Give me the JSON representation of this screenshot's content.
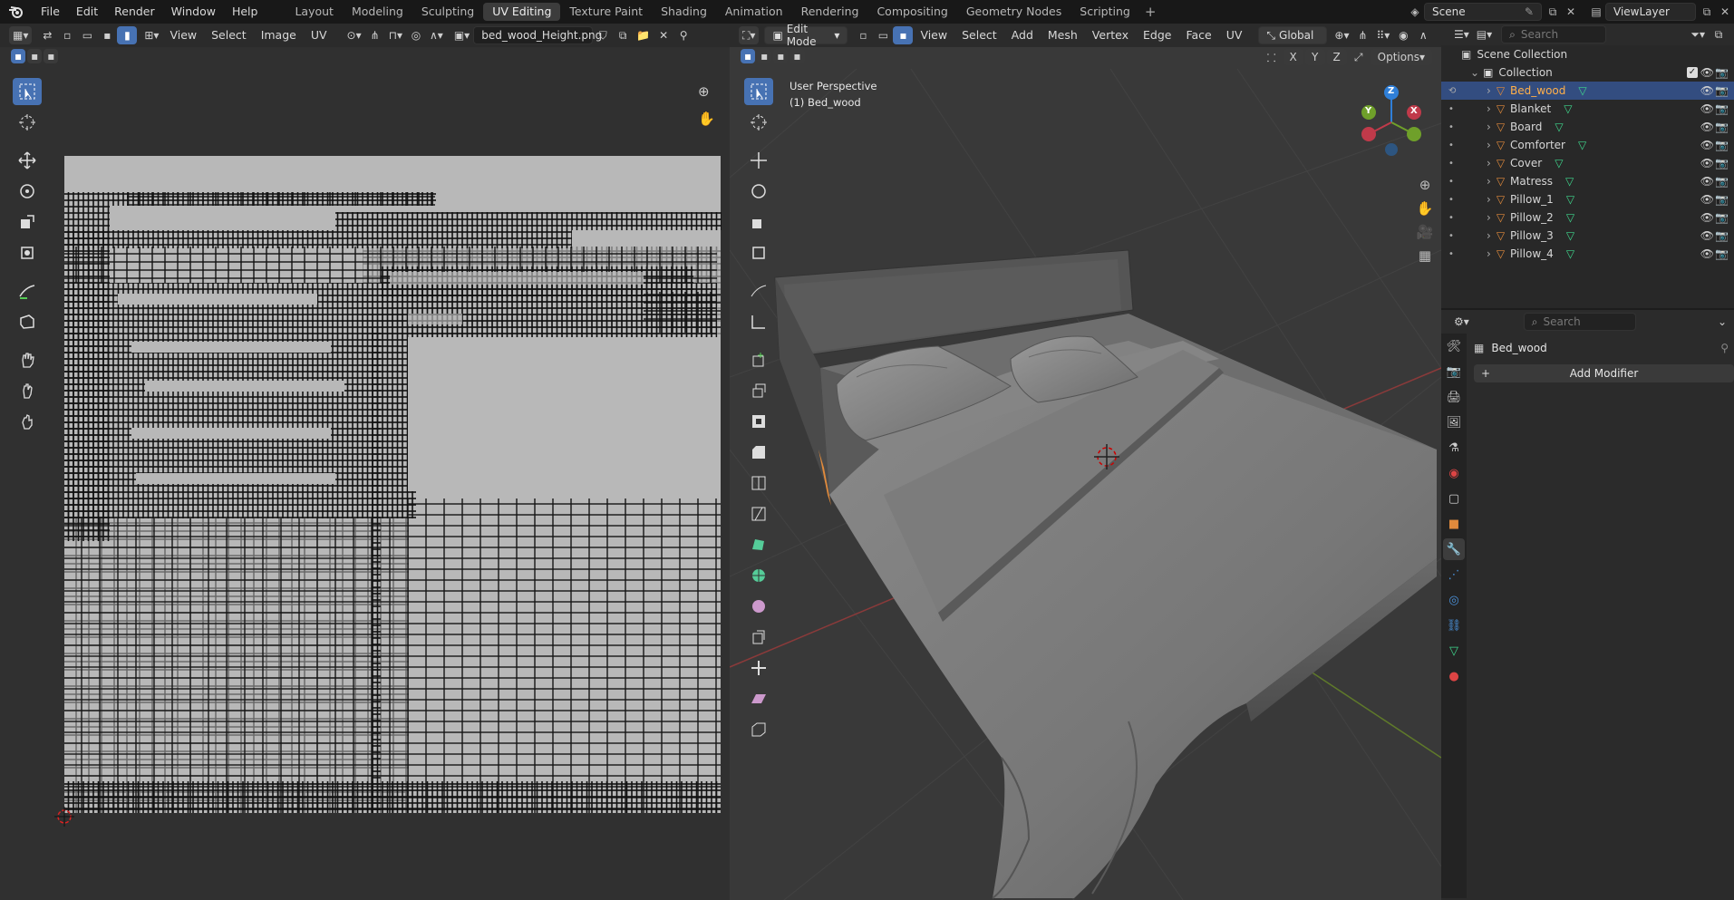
{
  "app": {
    "logo": "blender-logo"
  },
  "menus": [
    "File",
    "Edit",
    "Render",
    "Window",
    "Help"
  ],
  "workspaces": [
    {
      "label": "Layout"
    },
    {
      "label": "Modeling"
    },
    {
      "label": "Sculpting"
    },
    {
      "label": "UV Editing",
      "active": true
    },
    {
      "label": "Texture Paint"
    },
    {
      "label": "Shading"
    },
    {
      "label": "Animation"
    },
    {
      "label": "Rendering"
    },
    {
      "label": "Compositing"
    },
    {
      "label": "Geometry Nodes"
    },
    {
      "label": "Scripting"
    }
  ],
  "workspace_add": "+",
  "scene": {
    "name": "Scene",
    "view_layer": "ViewLayer"
  },
  "uv_editor": {
    "menus": [
      "View",
      "Select",
      "Image",
      "UV"
    ],
    "image_name": "bed_wood_Height.png"
  },
  "viewport": {
    "mode": "Edit Mode",
    "menus": [
      "View",
      "Select",
      "Add",
      "Mesh",
      "Vertex",
      "Edge",
      "Face",
      "UV"
    ],
    "orientation": "Global",
    "options_label": "Options",
    "axis_x": "X",
    "axis_y": "Y",
    "axis_z": "Z",
    "perspective_label": "User Perspective",
    "object_label": "(1) Bed_wood",
    "gizmo": {
      "x": "X",
      "y": "Y",
      "z": "Z"
    }
  },
  "outliner": {
    "search_placeholder": "Search",
    "scene_collection": "Scene Collection",
    "collection": "Collection",
    "objects": [
      {
        "name": "Bed_wood",
        "selected": true
      },
      {
        "name": "Blanket"
      },
      {
        "name": "Board"
      },
      {
        "name": "Comforter"
      },
      {
        "name": "Cover"
      },
      {
        "name": "Matress"
      },
      {
        "name": "Pillow_1"
      },
      {
        "name": "Pillow_2"
      },
      {
        "name": "Pillow_3"
      },
      {
        "name": "Pillow_4"
      }
    ]
  },
  "properties": {
    "search_placeholder": "Search",
    "object_name": "Bed_wood",
    "add_modifier": "Add Modifier",
    "add_modifier_icon": "+"
  },
  "colors": {
    "accent": "#4772b3",
    "selected_row": "#334d80",
    "object_icon": "#e08a3c",
    "mesh_icon": "#3fd68c",
    "eye": "#d0d0d0"
  }
}
